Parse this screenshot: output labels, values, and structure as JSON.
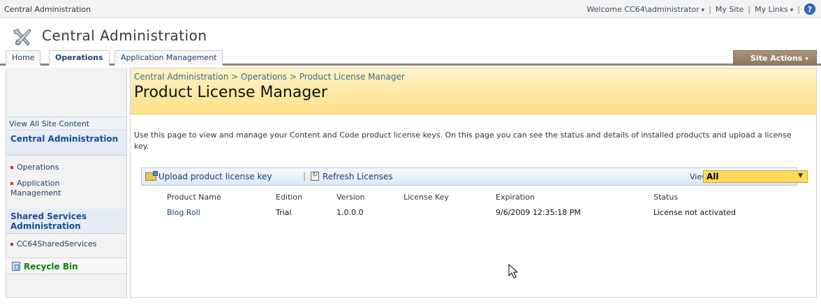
{
  "topbar": {
    "site_label": "Central Administration",
    "welcome": "Welcome CC64\\administrator",
    "my_site": "My Site",
    "my_links": "My Links",
    "help_glyph": "?",
    "separator": "|"
  },
  "header": {
    "app_title": "Central Administration",
    "app_icon": "tools-icon"
  },
  "tabs": [
    {
      "label": "Home",
      "selected": false
    },
    {
      "label": "Operations",
      "selected": true
    },
    {
      "label": "Application Management",
      "selected": false
    }
  ],
  "site_actions": {
    "label": "Site Actions",
    "caret": "▾"
  },
  "leftnav": {
    "view_all": "View All Site Content",
    "sections": [
      {
        "heading": "Central Administration",
        "items": [
          "Operations",
          "Application Management"
        ]
      },
      {
        "heading": "Shared Services Administration",
        "items": [
          "CC64SharedServices"
        ]
      }
    ],
    "recycle_bin": "Recycle Bin"
  },
  "main": {
    "breadcrumb": {
      "parts": [
        "Central Administration",
        "Operations",
        "Product License Manager"
      ],
      "separator": ">"
    },
    "title": "Product License Manager",
    "description": "Use this page to view and manage your Content and Code product license keys. On this page you can see the status and details of installed products and upload a license key.",
    "toolbar": {
      "upload": "Upload product license key",
      "separator": "|",
      "refresh": "Refresh Licenses",
      "view_label": "View",
      "view_value": "All"
    },
    "table": {
      "columns": [
        "Product Name",
        "Edition",
        "Version",
        "License Key",
        "Expiration",
        "Status"
      ],
      "rows": [
        [
          "Blog Roll",
          "Trial",
          "1.0.0.0",
          "",
          "9/6/2009 12:35:18 PM",
          "License not activated"
        ]
      ]
    }
  },
  "colors": {
    "banner": "#ffdf88",
    "link": "#1c3f75",
    "site_actions": "#8b785e",
    "view_select": "#ffd95a",
    "recycle": "#127a12"
  }
}
